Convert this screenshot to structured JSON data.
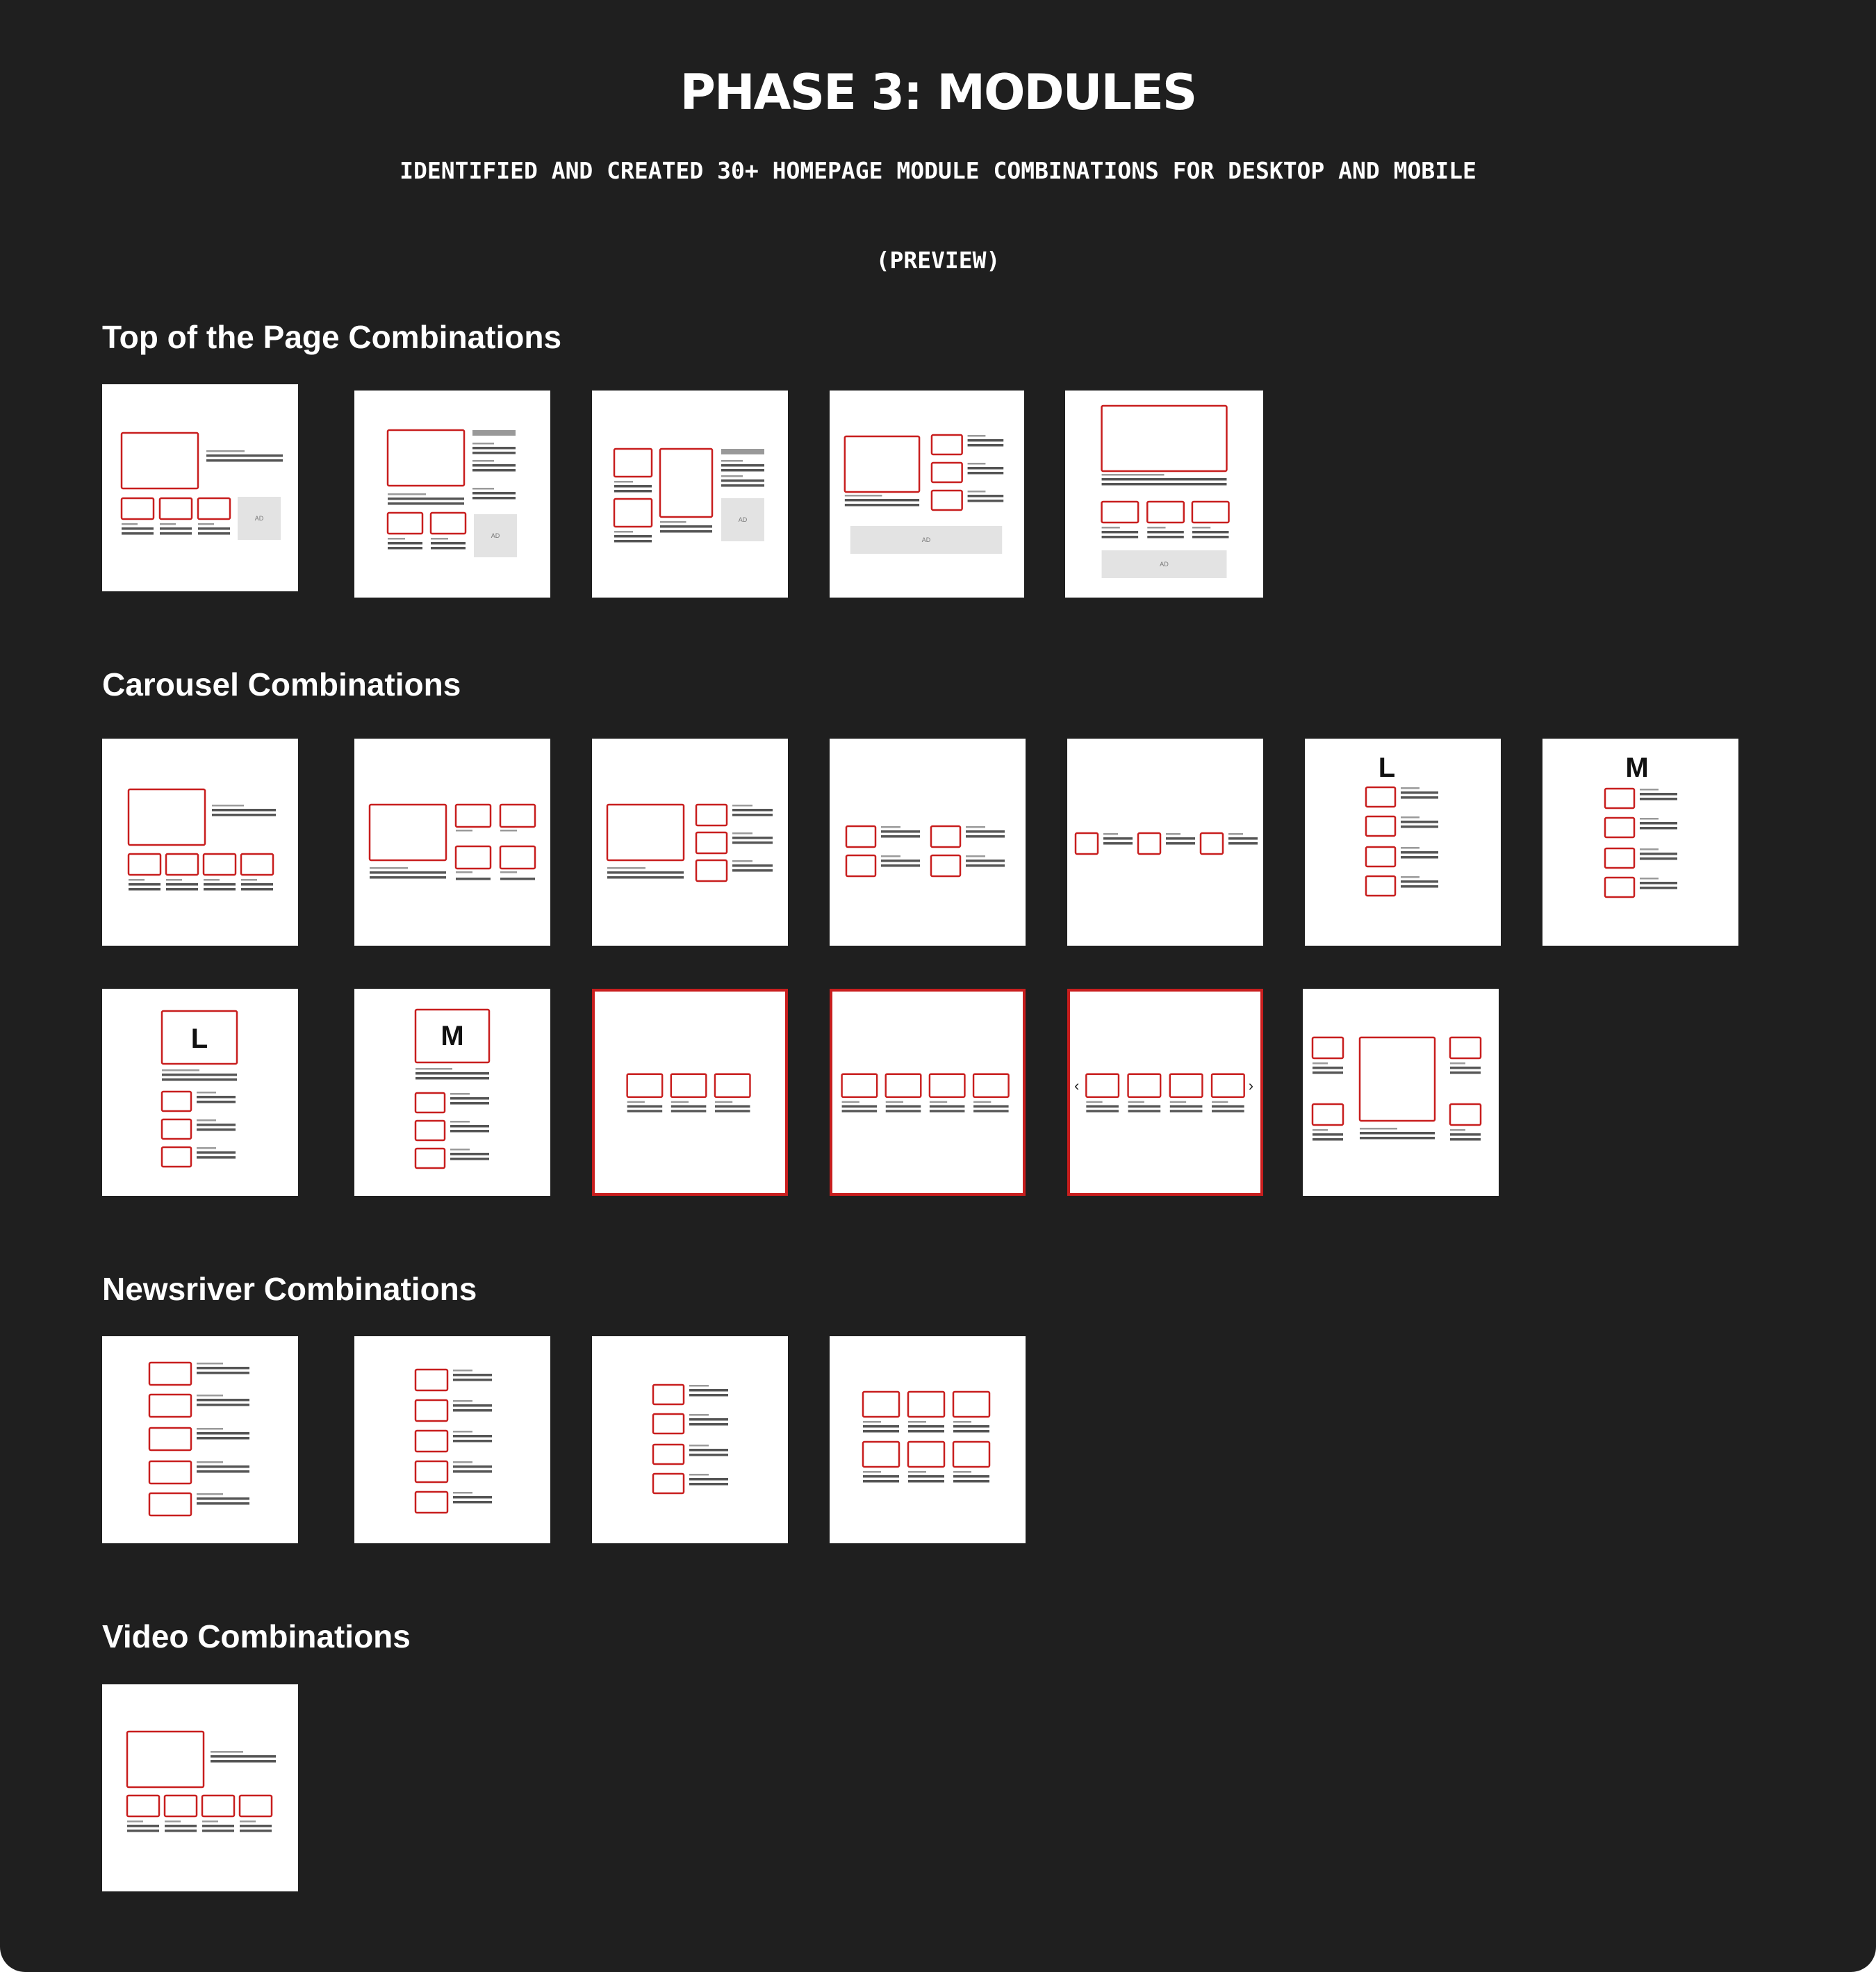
{
  "header": {
    "title": "PHASE 3: MODULES",
    "subtitle": "IDENTIFIED AND CREATED 30+ HOMEPAGE MODULE COMBINATIONS FOR DESKTOP AND MOBILE",
    "preview": "(PREVIEW)"
  },
  "sections": {
    "top": "Top of the Page Combinations",
    "carousel": "Carousel Combinations",
    "newsriver": "Newsriver Combinations",
    "video": "Video Combinations"
  },
  "labels": {
    "ad": "AD",
    "large": "L",
    "medium": "M",
    "prev": "‹",
    "next": "›"
  },
  "colors": {
    "background": "#1f1f1f",
    "card": "#ffffff",
    "accent_red": "#c81e1e",
    "text_bar": "#555555",
    "ad_block": "#e3e3e3"
  }
}
